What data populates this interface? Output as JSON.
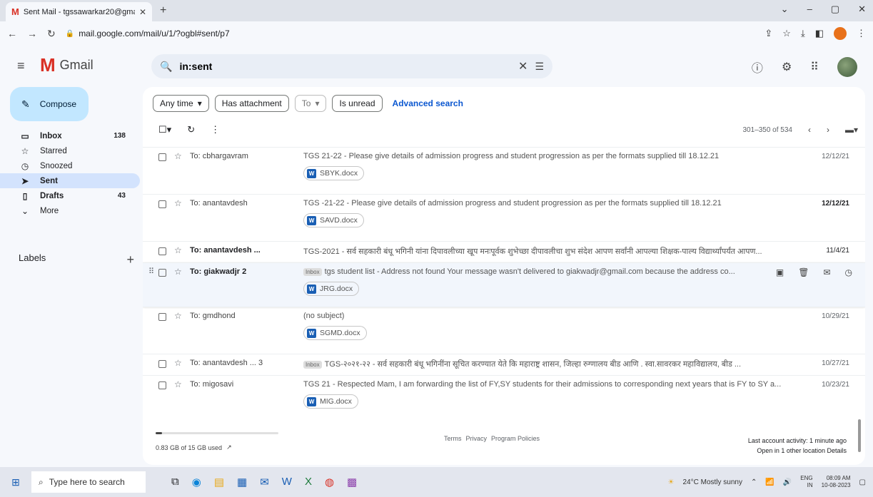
{
  "browser": {
    "tab_title": "Sent Mail - tgssawarkar20@gma",
    "url": "mail.google.com/mail/u/1/?ogbl#sent/p7"
  },
  "header": {
    "logo_text": "Gmail",
    "search_value": "in:sent"
  },
  "sidebar": {
    "compose_label": "Compose",
    "items": [
      {
        "label": "Inbox",
        "count": "138",
        "icon": "inbox-icon"
      },
      {
        "label": "Starred",
        "count": "",
        "icon": "star-icon"
      },
      {
        "label": "Snoozed",
        "count": "",
        "icon": "clock-icon"
      },
      {
        "label": "Sent",
        "count": "",
        "icon": "send-icon"
      },
      {
        "label": "Drafts",
        "count": "43",
        "icon": "draft-icon"
      },
      {
        "label": "More",
        "count": "",
        "icon": "chevron-down-icon"
      }
    ],
    "labels_title": "Labels"
  },
  "filters": {
    "any_time": "Any time",
    "has_attachment": "Has attachment",
    "to": "To",
    "is_unread": "Is unread",
    "advanced_search": "Advanced search"
  },
  "pagination": {
    "range": "301–350 of 534"
  },
  "emails": [
    {
      "to": "To: cbhargavram",
      "subject": "TGS 21-22 - Please give details of admission progress and student progression as per the formats supplied till 18.12.21",
      "date": "12/12/21",
      "attachment": "SBYK.docx",
      "tag": ""
    },
    {
      "to": "To: anantavdesh",
      "subject": "TGS -21-22 - Please give details of admission progress and student progression as per the formats supplied till 18.12.21",
      "date": "12/12/21",
      "attachment": "SAVD.docx",
      "tag": ""
    },
    {
      "to": "To: anantavdesh ...",
      "subject": "TGS-2021 - सर्व सहकारी बंधू भगिनी यांना दिपावलीच्या खूप मनःपूर्वक शुभेच्छा दीपावलीचा शुभ संदेश आपण सर्वांनी आपल्या शिक्षक-पाल्य विद्यार्थ्यांपर्यंत आपण...",
      "date": "11/4/21",
      "attachment": "",
      "tag": ""
    },
    {
      "to": "To: giakwadjr 2",
      "subject": "tgs student list - Address not found Your message wasn't delivered to giakwadjr@gmail.com because the address co...",
      "date": "",
      "attachment": "JRG.docx",
      "tag": "Inbox"
    },
    {
      "to": "To: gmdhond",
      "subject": "(no subject)",
      "date": "10/29/21",
      "attachment": "SGMD.docx",
      "tag": ""
    },
    {
      "to": "To: anantavdesh ... 3",
      "subject": "TGS-२०२१-२२ - सर्व सहकारी बंधू भगिनींना सूचित करण्यात येते कि महाराष्ट्र शासन, जिल्हा रुग्णालय बीड आणि . स्वा.सावरकर महाविद्यालय, बीड ...",
      "date": "10/27/21",
      "attachment": "",
      "tag": "Inbox"
    },
    {
      "to": "To: migosavi",
      "subject": "TGS 21 - Respected Mam, I am forwarding the list of FY,SY students for their admissions to corresponding next years that is FY to SY a...",
      "date": "10/23/21",
      "attachment": "MIG.docx",
      "tag": ""
    }
  ],
  "footer": {
    "storage": "0.83 GB of 15 GB used",
    "storage_fraction": 0.055,
    "terms": "Terms",
    "privacy": "Privacy",
    "program_policies": "Program Policies",
    "last_activity": "Last account activity: 1 minute ago",
    "open_in": "Open in 1 other location",
    "details": "Details"
  },
  "taskbar": {
    "search_placeholder": "Type here to search",
    "weather": "24°C  Mostly sunny",
    "lang_1": "ENG",
    "lang_2": "IN",
    "time": "08:09 AM",
    "date": "10-08-2023"
  }
}
